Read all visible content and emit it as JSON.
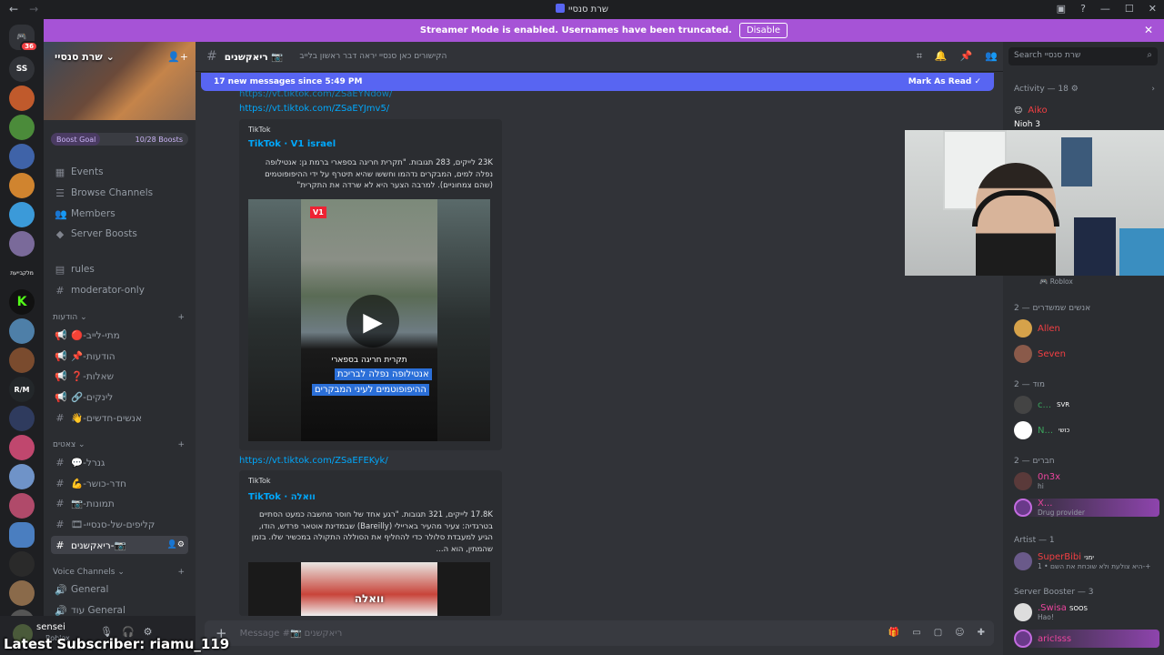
{
  "window": {
    "title": "שרת סנסיי"
  },
  "streamer_mode": {
    "text": "Streamer Mode is enabled. Usernames have been truncated.",
    "button": "Disable"
  },
  "guild_bar": {
    "home_badge": "36",
    "text_icons": [
      "SS",
      "מלקבייעת"
    ]
  },
  "server": {
    "name": "שרת סנסיי",
    "boost_goal": {
      "label": "Boost Goal",
      "progress": "10/28 Boosts",
      "fraction": 0.357
    },
    "nav": [
      "Events",
      "Browse Channels",
      "Members",
      "Server Boosts"
    ],
    "channels_top": [
      "rules",
      "moderator-only"
    ],
    "category_announcements": "הודעות",
    "channels_announcements": [
      "🔴-מתי-לייב",
      "📌-הודעות",
      "❓-שאלות",
      "🔗-לינקים",
      "👋-אנשים-חדשים"
    ],
    "category_chats": "צאטים",
    "channels_chats": [
      "💬-גנרל",
      "💪-חדר-כושר",
      "📷-תמונות",
      "🎞-קליפים-של-סנסיי",
      "ריאקשנים-📷"
    ],
    "category_voice": "Voice Channels",
    "voice_channels": [
      "General",
      "עוד General"
    ]
  },
  "user": {
    "name": "sensei",
    "status": "Roblox"
  },
  "channel": {
    "name": "ריאקשנים",
    "topic": "הקישורים כאן סנסיי יראה דבר ראשון בלייב",
    "new_messages": "17 new messages since 5:49 PM",
    "mark_read": "Mark As Read",
    "composer_placeholder": "Message #📷 ריאקשנים"
  },
  "messages": {
    "link0": "https://vt.tiktok.com/ZSaEYNdow/",
    "link1": "https://vt.tiktok.com/ZSaEYJmv5/",
    "embed1": {
      "provider": "TikTok",
      "title": "TikTok · V1 israel",
      "desc": "23K לייקים, 283 תגובות. \"תקרית חריגה בספארי ברמת גן: אנטילופה נפלה למים, המבקרים נדהמו וחששו שהיא תיטרף על ידי ההיפופוטמים (שהם צמחוניים). למרבה הצער היא לא שרדה את התקרית\"",
      "logo": "V1",
      "caption1": "תקרית חריגה בספארי",
      "caption2": "אנטילופה נפלה לבריכת",
      "caption3": "ההיפופוטמים לעיני המבקרים"
    },
    "link2": "https://vt.tiktok.com/ZSaEFEKyk/",
    "embed2": {
      "provider": "TikTok",
      "title": "TikTok · וואלה",
      "desc": "17.8K לייקים, 321 תגובות. \"רגע אחד של חוסר מחשבה כמעט הסתיים בטרגדיה: צעיר מהעיר באריילי (Bareilly) שבמדינת אוטאר פרדש, הודו, הגיע למעבדת סלולר כדי להחליף את הסוללה התקולה במכשיר שלו. בזמן שהמתין, הוא ה...",
      "thumb_text": "וואלה"
    }
  },
  "members_panel": {
    "search_placeholder": "Search שרת סנסיי",
    "activity": "Activity — 18",
    "activity_user": "Aiko",
    "activity_game": "Nioh 3",
    "roblox_status": "Roblox",
    "groups": [
      {
        "title": "אנשים שמשדרים — 2",
        "members": [
          {
            "name": "Allen",
            "color": "#f23f43",
            "sub": ""
          },
          {
            "name": "Seven",
            "color": "#f23f43",
            "sub": ""
          }
        ]
      },
      {
        "title": "מוד — 2",
        "members": [
          {
            "name": "c...",
            "color": "#3ba55d",
            "sub": "",
            "tag": "SVR"
          },
          {
            "name": "N...",
            "color": "#3ba55d",
            "sub": "",
            "tag": "כושי"
          }
        ]
      },
      {
        "title": "חברים — 2",
        "members": [
          {
            "name": "0n3x",
            "color": "#eb459e",
            "sub": "hi"
          },
          {
            "name": "X...",
            "color": "#eb459e",
            "sub": "Drug provider"
          }
        ]
      },
      {
        "title": "Artist — 1",
        "members": [
          {
            "name": "SuperBibi",
            "color": "#f23f43",
            "sub": "היא צולעת ולא שוכחת את השם • 1-+",
            "tag": "ימני"
          }
        ]
      },
      {
        "title": "Server Booster — 3",
        "members": [
          {
            "name": ".Swisa",
            "color": "#eb459e",
            "sub": "Hao!",
            "tag": "SOOS"
          },
          {
            "name": "aricIsss",
            "color": "#eb459e",
            "sub": ""
          }
        ]
      }
    ]
  },
  "overlay": {
    "subscriber": "Latest Subscriber: riamu_119"
  },
  "colors": {
    "accent": "#5865f2",
    "streamer": "#a653d6",
    "link": "#00a8fc"
  }
}
